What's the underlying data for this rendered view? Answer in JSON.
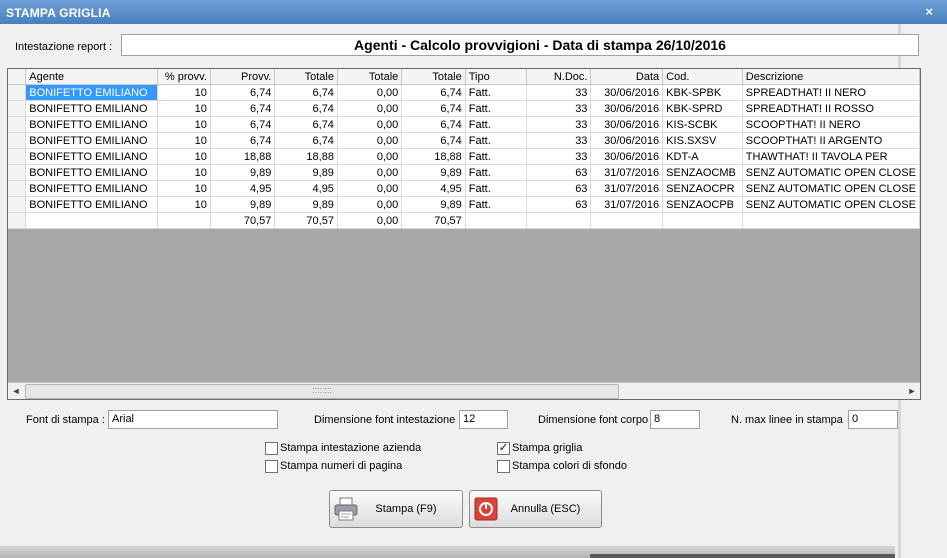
{
  "window": {
    "title": "STAMPA GRIGLIA",
    "close_glyph": "×"
  },
  "report": {
    "label": "Intestazione report :",
    "value": "Agenti - Calcolo provvigioni - Data di stampa 26/10/2016"
  },
  "grid": {
    "columns": [
      "Agente",
      "% provv.",
      "Provv.",
      "Totale",
      "Totale",
      "Totale",
      "Tipo",
      "N.Doc.",
      "Data",
      "Cod.",
      "Descrizione"
    ],
    "rows": [
      [
        "BONIFETTO EMILIANO",
        "10",
        "6,74",
        "6,74",
        "0,00",
        "6,74",
        "Fatt.",
        "33",
        "30/06/2016",
        "KBK-SPBK",
        "SPREADTHAT! II NERO"
      ],
      [
        "BONIFETTO EMILIANO",
        "10",
        "6,74",
        "6,74",
        "0,00",
        "6,74",
        "Fatt.",
        "33",
        "30/06/2016",
        "KBK-SPRD",
        "SPREADTHAT! II ROSSO"
      ],
      [
        "BONIFETTO EMILIANO",
        "10",
        "6,74",
        "6,74",
        "0,00",
        "6,74",
        "Fatt.",
        "33",
        "30/06/2016",
        "KIS-SCBK",
        "SCOOPTHAT! II NERO"
      ],
      [
        "BONIFETTO EMILIANO",
        "10",
        "6,74",
        "6,74",
        "0,00",
        "6,74",
        "Fatt.",
        "33",
        "30/06/2016",
        "KIS.SXSV",
        "SCOOPTHAT! II ARGENTO"
      ],
      [
        "BONIFETTO EMILIANO",
        "10",
        "18,88",
        "18,88",
        "0,00",
        "18,88",
        "Fatt.",
        "33",
        "30/06/2016",
        "KDT-A",
        "THAWTHAT! II  TAVOLA PER"
      ],
      [
        "BONIFETTO EMILIANO",
        "10",
        "9,89",
        "9,89",
        "0,00",
        "9,89",
        "Fatt.",
        "63",
        "31/07/2016",
        "SENZAOCMB",
        "SENZ AUTOMATIC OPEN CLOSE"
      ],
      [
        "BONIFETTO EMILIANO",
        "10",
        "4,95",
        "4,95",
        "0,00",
        "4,95",
        "Fatt.",
        "63",
        "31/07/2016",
        "SENZAOCPR",
        "SENZ AUTOMATIC OPEN CLOSE"
      ],
      [
        "BONIFETTO EMILIANO",
        "10",
        "9,89",
        "9,89",
        "0,00",
        "9,89",
        "Fatt.",
        "63",
        "31/07/2016",
        "SENZAOCPB",
        "SENZ AUTOMATIC OPEN CLOSE"
      ]
    ],
    "totals": [
      "",
      "",
      "70,57",
      "70,57",
      "0,00",
      "70,57",
      "",
      "",
      "",
      "",
      ""
    ],
    "scroll_grip": "::::::::"
  },
  "options": {
    "font_label": "Font di stampa :",
    "font_value": "Arial",
    "header_size_label": "Dimensione font intestazione",
    "header_size_value": "12",
    "body_size_label": "Dimensione font corpo",
    "body_size_value": "8",
    "max_lines_label": "N. max linee in stampa",
    "max_lines_value": "0"
  },
  "checkboxes": [
    {
      "label": "Stampa intestazione azienda",
      "checked": false
    },
    {
      "label": "Stampa numeri di pagina",
      "checked": false
    },
    {
      "label": "Stampa griglia",
      "checked": true
    },
    {
      "label": "Stampa colori di sfondo",
      "checked": false
    }
  ],
  "buttons": {
    "print": "Stampa (F9)",
    "cancel": "Annulla (ESC)"
  },
  "icons": {
    "close": "close-icon",
    "print": "printer-icon",
    "cancel": "cancel-icon"
  },
  "colors": {
    "title_bar": "#4a7fc0",
    "selection": "#3399ff",
    "grid_empty": "#a8a8a8",
    "check": "#1a7a1a",
    "cancel_icon": "#d9443a"
  }
}
